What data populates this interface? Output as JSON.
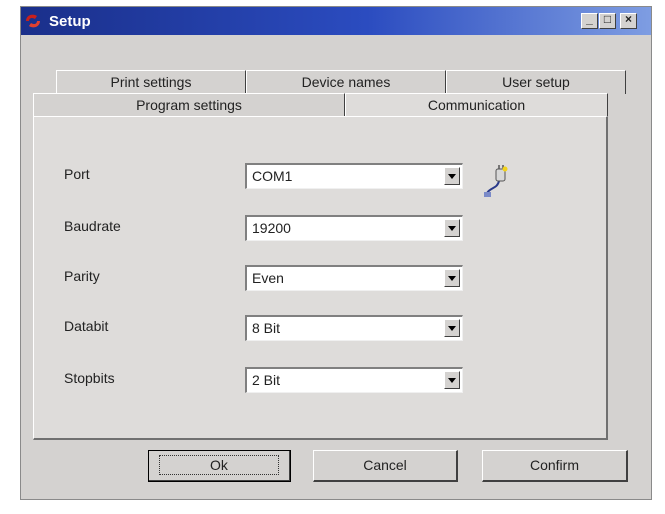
{
  "window": {
    "title": "Setup"
  },
  "tabs": {
    "row_top": [
      "Print settings",
      "Device names",
      "User setup"
    ],
    "row_bottom": [
      "Program settings",
      "Communication"
    ],
    "active": "Communication"
  },
  "form": {
    "port": {
      "label": "Port",
      "value": "COM1"
    },
    "baudrate": {
      "label": "Baudrate",
      "value": "19200"
    },
    "parity": {
      "label": "Parity",
      "value": "Even"
    },
    "databit": {
      "label": "Databit",
      "value": "8 Bit"
    },
    "stopbits": {
      "label": "Stopbits",
      "value": "2 Bit"
    }
  },
  "buttons": {
    "ok": "Ok",
    "cancel": "Cancel",
    "confirm": "Confirm"
  },
  "icons": {
    "app": "setup-app-icon",
    "connection": "connection-plug-icon"
  }
}
